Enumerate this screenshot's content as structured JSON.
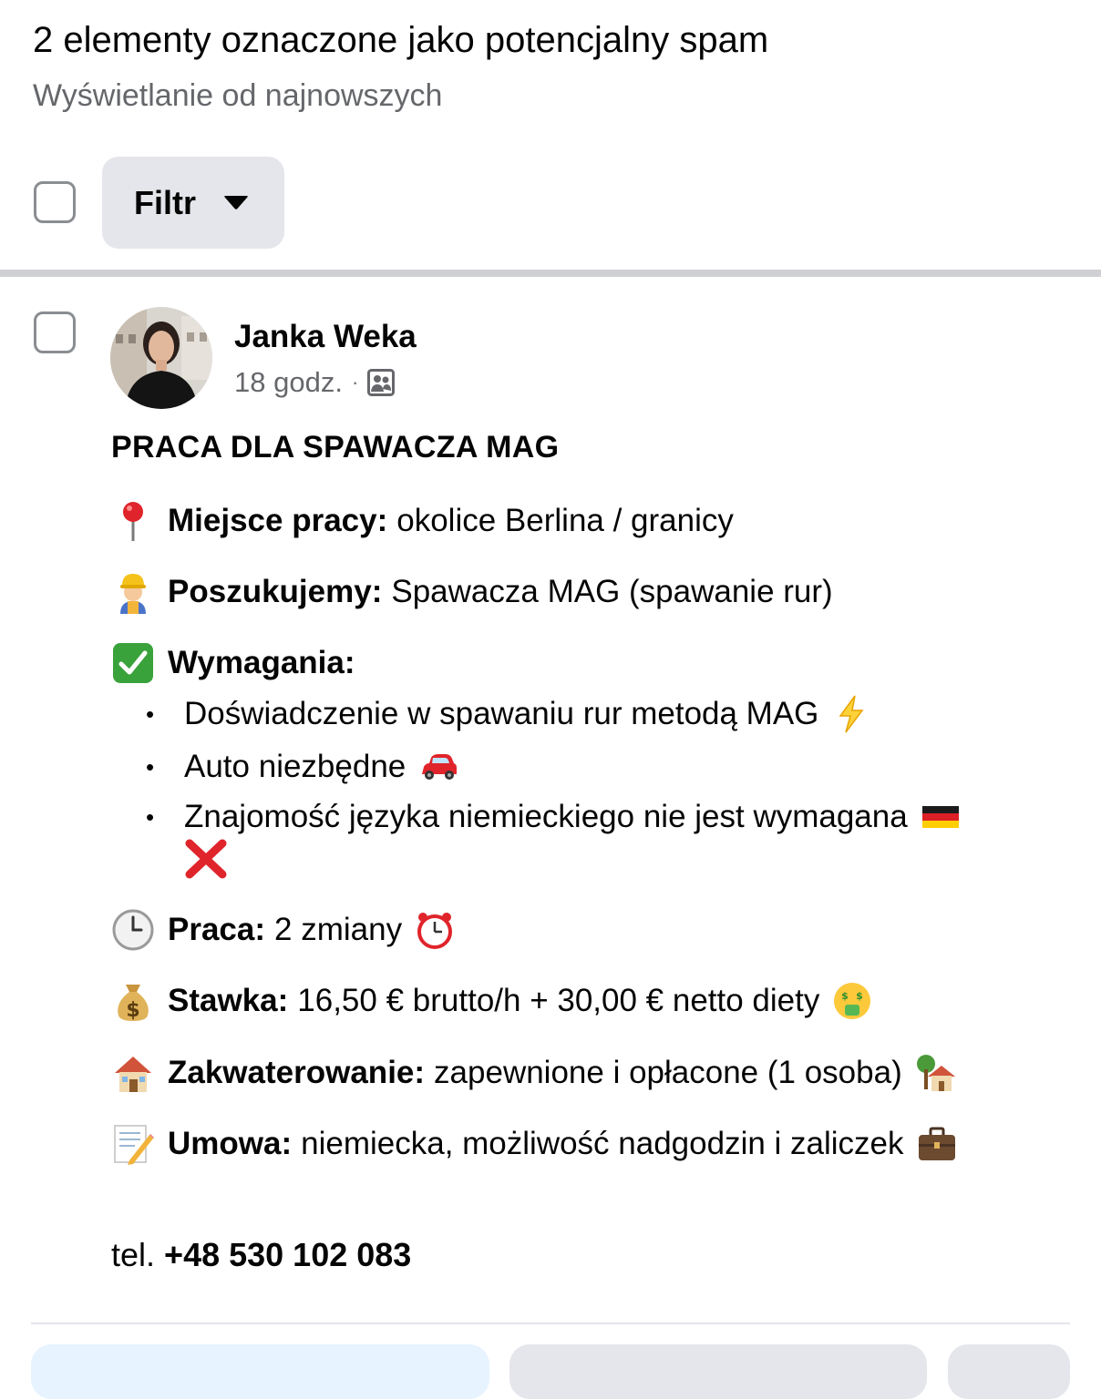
{
  "header": {
    "title": "2 elementy oznaczone jako potencjalny spam",
    "subtitle": "Wyświetlanie od najnowszych"
  },
  "toolbar": {
    "filter_label": "Filtr"
  },
  "post": {
    "author": "Janka Weka",
    "time": "18 godz.",
    "separator": "·",
    "audience_icon": "group-members-icon",
    "title": "PRACA DLA SPAWACZA MAG",
    "lines": {
      "location": {
        "icon": "round-pushpin-icon",
        "label": "Miejsce pracy:",
        "value": "okolice Berlina / granicy"
      },
      "seeking": {
        "icon": "construction-worker-icon",
        "label": "Poszukujemy:",
        "value": "Spawacza MAG (spawanie rur)"
      },
      "requirements": {
        "icon": "check-mark-button-icon",
        "label": "Wymagania:"
      },
      "shift": {
        "icon": "clock-icon",
        "label": "Praca:",
        "value": "2 zmiany",
        "trailing_icon": "alarm-clock-icon"
      },
      "rate": {
        "icon": "money-bag-icon",
        "label": "Stawka:",
        "value": "16,50 € brutto/h + 30,00 € netto diety",
        "trailing_icon": "money-mouth-face-icon"
      },
      "housing": {
        "icon": "house-icon",
        "label": "Zakwaterowanie:",
        "value": "zapewnione i opłacone (1 osoba)",
        "trailing_icon": "house-with-garden-icon"
      },
      "contract": {
        "icon": "memo-icon",
        "label": "Umowa:",
        "value": "niemiecka, możliwość nadgodzin i zaliczek",
        "trailing_icon": "briefcase-icon"
      }
    },
    "bullets": [
      {
        "text": "Doświadczenie w spawaniu rur metodą MAG",
        "icon": "high-voltage-icon"
      },
      {
        "text": "Auto niezbędne",
        "icon": "red-car-icon"
      },
      {
        "text": "Znajomość języka niemieckiego nie jest wymagana",
        "icon": "germany-flag-icon",
        "icon2": "cross-mark-icon"
      }
    ],
    "bullet_glyph": "•",
    "phone_prefix": "tel.",
    "phone_number": "+48 530 102 083"
  },
  "colors": {
    "primary_text": "#050505",
    "secondary_text": "#65676b",
    "button_bg": "#e4e6eb",
    "divider": "#ced0d4",
    "primary_button_bg": "#e7f3ff"
  }
}
